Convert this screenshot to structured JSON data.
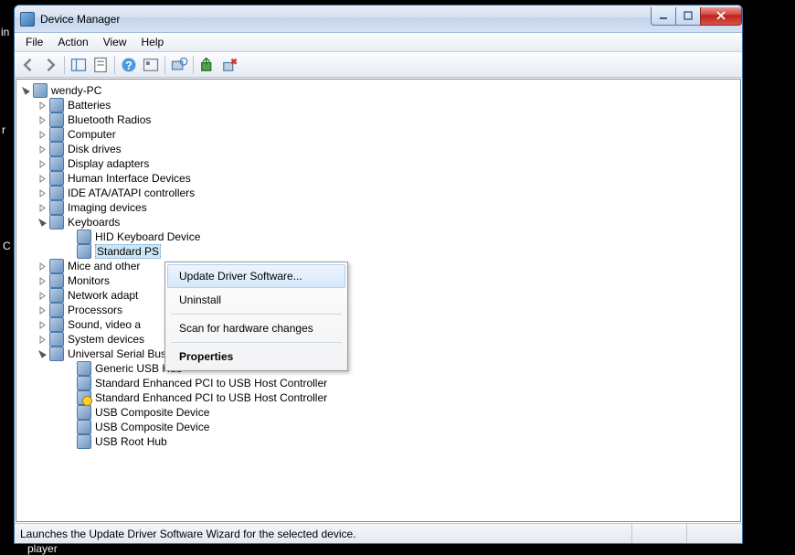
{
  "window": {
    "title": "Device Manager"
  },
  "menu": {
    "items": [
      "File",
      "Action",
      "View",
      "Help"
    ]
  },
  "tree": {
    "root": "wendy-PC",
    "nodes": [
      {
        "label": "Batteries",
        "icon": "ico-battery",
        "expanded": false
      },
      {
        "label": "Bluetooth Radios",
        "icon": "ico-bluetooth",
        "expanded": false
      },
      {
        "label": "Computer",
        "icon": "ico-computer",
        "expanded": false
      },
      {
        "label": "Disk drives",
        "icon": "ico-disk",
        "expanded": false
      },
      {
        "label": "Display adapters",
        "icon": "ico-display",
        "expanded": false
      },
      {
        "label": "Human Interface Devices",
        "icon": "ico-hid",
        "expanded": false
      },
      {
        "label": "IDE ATA/ATAPI controllers",
        "icon": "ico-ata",
        "expanded": false
      },
      {
        "label": "Imaging devices",
        "icon": "ico-imaging",
        "expanded": false
      },
      {
        "label": "Keyboards",
        "icon": "ico-keyboard",
        "expanded": true,
        "children": [
          {
            "label": "HID Keyboard Device",
            "icon": "ico-keyboard"
          },
          {
            "label": "Standard PS",
            "icon": "ico-keyboard",
            "selected": true
          }
        ]
      },
      {
        "label": "Mice and other",
        "icon": "ico-mouse",
        "expanded": false
      },
      {
        "label": "Monitors",
        "icon": "ico-monitor",
        "expanded": false
      },
      {
        "label": "Network adapt",
        "icon": "ico-network",
        "expanded": false
      },
      {
        "label": "Processors",
        "icon": "ico-cpu",
        "expanded": false
      },
      {
        "label": "Sound, video a",
        "icon": "ico-sound",
        "expanded": false
      },
      {
        "label": "System devices",
        "icon": "ico-system",
        "expanded": false
      },
      {
        "label": "Universal Serial Bus controllers",
        "icon": "ico-usb",
        "expanded": true,
        "children": [
          {
            "label": "Generic USB Hub",
            "icon": "ico-usb-child"
          },
          {
            "label": "Standard Enhanced PCI to USB Host Controller",
            "icon": "ico-usb-child"
          },
          {
            "label": "Standard Enhanced PCI to USB Host Controller",
            "icon": "ico-usb-warn"
          },
          {
            "label": "USB Composite Device",
            "icon": "ico-usb-child"
          },
          {
            "label": "USB Composite Device",
            "icon": "ico-usb-child"
          },
          {
            "label": "USB Root Hub",
            "icon": "ico-usb-child"
          }
        ]
      }
    ]
  },
  "context_menu": {
    "items": [
      {
        "label": "Update Driver Software...",
        "hover": true
      },
      {
        "label": "Uninstall"
      },
      {
        "sep": true
      },
      {
        "label": "Scan for hardware changes"
      },
      {
        "sep": true
      },
      {
        "label": "Properties",
        "bold": true
      }
    ]
  },
  "statusbar": {
    "text": "Launches the Update Driver Software Wizard for the selected device."
  },
  "desktop": {
    "frag1": "in",
    "frag2": "r",
    "frag3": "C",
    "frag4": "player"
  }
}
